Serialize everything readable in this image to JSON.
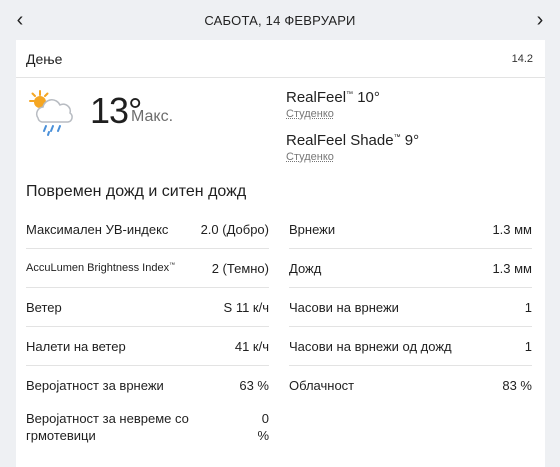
{
  "topbar": {
    "prev_icon": "chevron-left-icon",
    "date": "САБОТА, 14 ФЕВРУАРИ",
    "next_icon": "chevron-right-icon"
  },
  "card": {
    "phase": "Дење",
    "time": "14.2",
    "icon": "sun-cloud-rain-icon",
    "temp": "13°",
    "temp_label": "Макс.",
    "realfeel": {
      "label": "RealFeel",
      "value": " 10°",
      "sub": "Студенко"
    },
    "realfeel_shade": {
      "label": "RealFeel Shade",
      "value": " 9°",
      "sub": "Студенко"
    },
    "phrase": "Повремен дожд и ситен дожд",
    "left": [
      {
        "key": "Максимален УВ-индекс",
        "value": "2.0 (Добро)"
      },
      {
        "key": "AccuLumen Brightness Index",
        "value": "2 (Темно)"
      },
      {
        "key": "Ветер",
        "value": "S 11 к/ч"
      },
      {
        "key": "Налети на ветер",
        "value": "41 к/ч"
      },
      {
        "key": "Веројатност за врнежи",
        "value": "63 %"
      },
      {
        "key": "Веројатност за невреме со грмотевици",
        "value": "0 %"
      }
    ],
    "right": [
      {
        "key": "Врнежи",
        "value": "1.3 мм"
      },
      {
        "key": "Дожд",
        "value": "1.3 мм"
      },
      {
        "key": "Часови на врнежи",
        "value": "1"
      },
      {
        "key": "Часови на врнежи од дожд",
        "value": "1"
      },
      {
        "key": "Облачност",
        "value": "83 %"
      }
    ],
    "tm": "™"
  }
}
